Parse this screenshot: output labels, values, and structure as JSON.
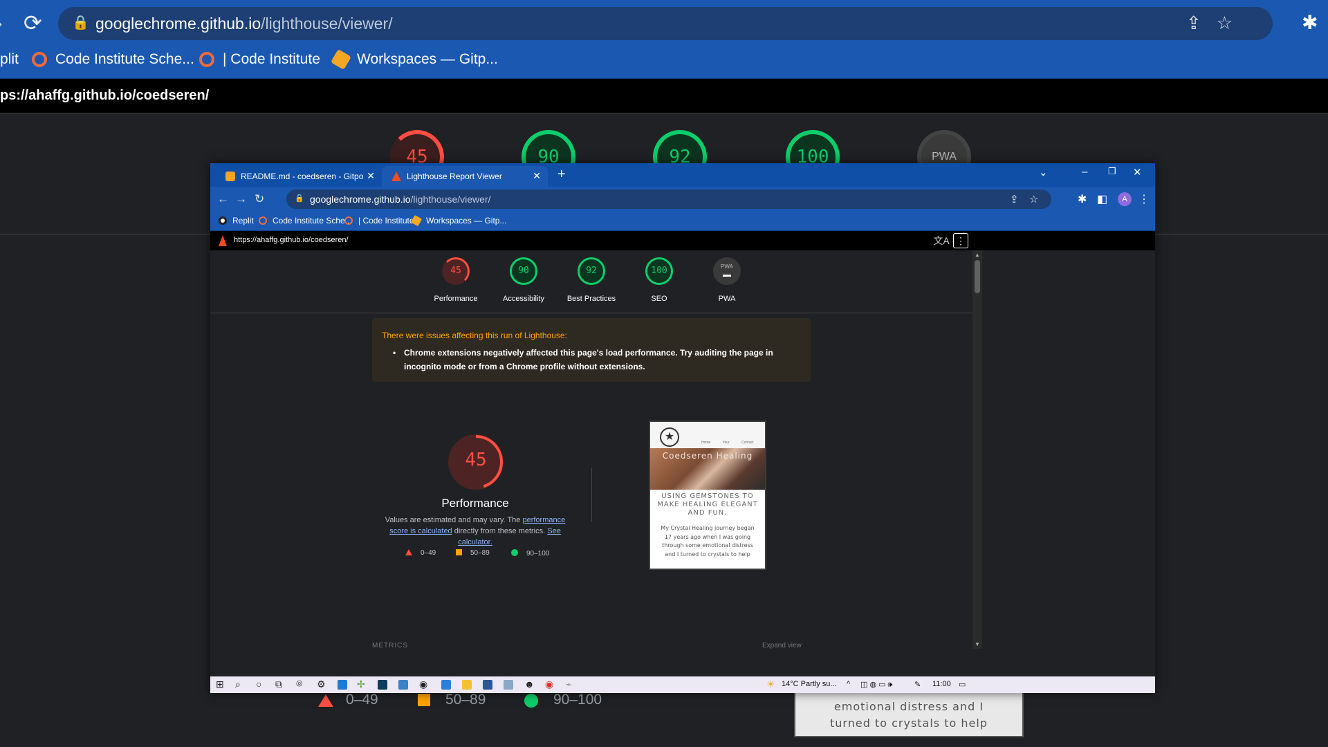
{
  "bg": {
    "url_host": "googlechrome.github.io",
    "url_path": "/lighthouse/viewer/",
    "bookmarks": [
      "plit",
      "Code Institute Sche...",
      "| Code Institute",
      "Workspaces — Gitp..."
    ],
    "report_url": "ps://ahaffg.github.io/coedseren/",
    "gauge_values": [
      "45",
      "90",
      "92",
      "100",
      "PWA"
    ],
    "legend": [
      "0–49",
      "50–89",
      "90–100"
    ],
    "screenshot_text": [
      "emotional distress and I",
      "turned to crystals to help"
    ]
  },
  "window": {
    "tabs": [
      {
        "title": "README.md - coedseren - Gitpo"
      },
      {
        "title": "Lighthouse Report Viewer"
      }
    ],
    "url_host": "googlechrome.github.io",
    "url_path": "/lighthouse/viewer/",
    "avatar_letter": "A",
    "bookmarks": [
      "Replit",
      "Code Institute Sche...",
      "| Code Institute",
      "Workspaces — Gitp..."
    ]
  },
  "report": {
    "url": "https://ahaffg.github.io/coedseren/",
    "gauges": [
      {
        "value": "45",
        "label": "Performance"
      },
      {
        "value": "90",
        "label": "Accessibility"
      },
      {
        "value": "92",
        "label": "Best Practices"
      },
      {
        "value": "100",
        "label": "SEO"
      },
      {
        "value": "PWA",
        "label": "PWA"
      }
    ],
    "warning": {
      "heading": "There were issues affecting this run of Lighthouse:",
      "item": "Chrome extensions negatively affected this page's load performance. Try auditing the page in incognito mode or from a Chrome profile without extensions."
    },
    "performance": {
      "score": "45",
      "score_fraction": 0.45,
      "title": "Performance",
      "desc_before": "Values are estimated and may vary. The",
      "link1": "performance score is calculated",
      "desc_mid": "directly from these metrics.",
      "link2": "See calculator.",
      "legend": [
        "0–49",
        "50–89",
        "90–100"
      ]
    },
    "screenshot": {
      "nav_links": "Home Your Contact",
      "hero_title": "Coedseren Healing",
      "tagline": "USING GEMSTONES TO MAKE HEALING ELEGANT AND FUN.",
      "body": "My Crystal Healing journey began 17 years ago when I was going through some emotional distress and I turned to crystals to help"
    },
    "metrics_label": "METRICS",
    "expand_label": "Expand view"
  },
  "taskbar": {
    "weather": "14°C  Partly su...",
    "time": "11:00"
  },
  "colors": {
    "fail": "#ff4e42",
    "average": "#ffa400",
    "pass": "#0cce6b",
    "chrome_blue": "#1a58b1"
  }
}
